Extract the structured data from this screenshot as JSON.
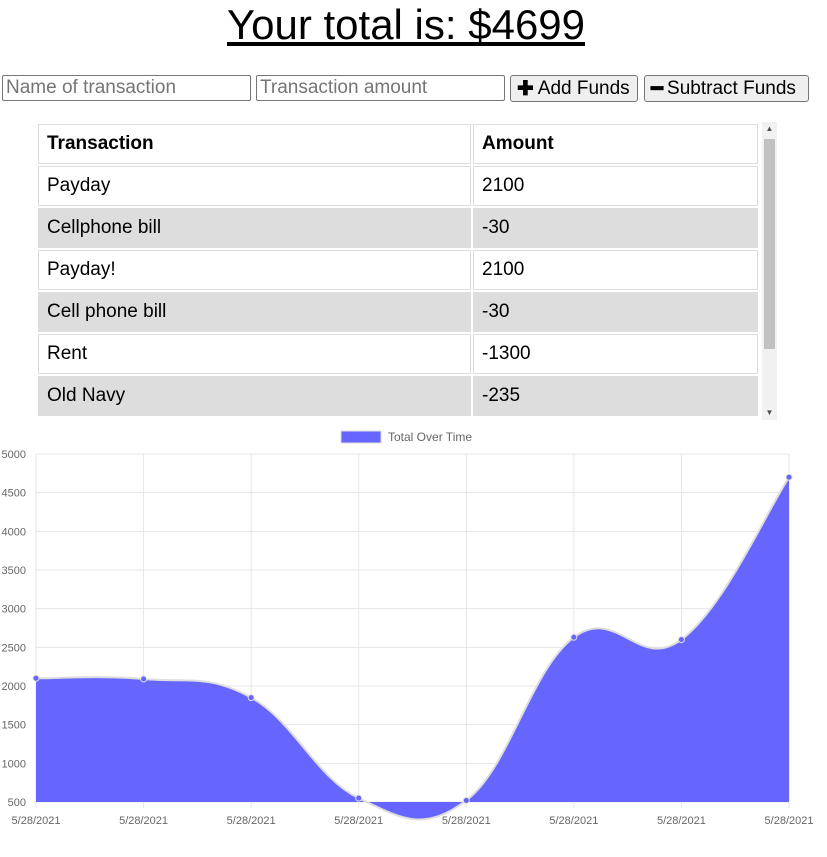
{
  "header": {
    "total_label": "Your total is: $4699"
  },
  "form": {
    "name_placeholder": "Name of transaction",
    "amount_placeholder": "Transaction amount",
    "add_label": "Add Funds",
    "subtract_label": "Subtract Funds"
  },
  "table": {
    "headers": [
      "Transaction",
      "Amount"
    ],
    "rows": [
      [
        "Payday",
        "2100"
      ],
      [
        "Cellphone bill",
        "-30"
      ],
      [
        "Payday!",
        "2100"
      ],
      [
        "Cell phone bill",
        "-30"
      ],
      [
        "Rent",
        "-1300"
      ],
      [
        "Old Navy",
        "-235"
      ]
    ]
  },
  "chart_data": {
    "type": "area",
    "legend": "Total Over Time",
    "legend_position": "top",
    "series": [
      {
        "name": "Total Over Time",
        "values": [
          2100,
          2090,
          1850,
          550,
          520,
          2630,
          2600,
          4699
        ]
      }
    ],
    "x": [
      "5/28/2021",
      "5/28/2021",
      "5/28/2021",
      "5/28/2021",
      "5/28/2021",
      "5/28/2021",
      "5/28/2021",
      "5/28/2021"
    ],
    "yticks": [
      500,
      1000,
      1500,
      2000,
      2500,
      3000,
      3500,
      4000,
      4500,
      5000
    ],
    "ylim": [
      500,
      5000
    ],
    "grid": true,
    "fill_color": "#6666ff",
    "line_color": "#dddddd"
  }
}
